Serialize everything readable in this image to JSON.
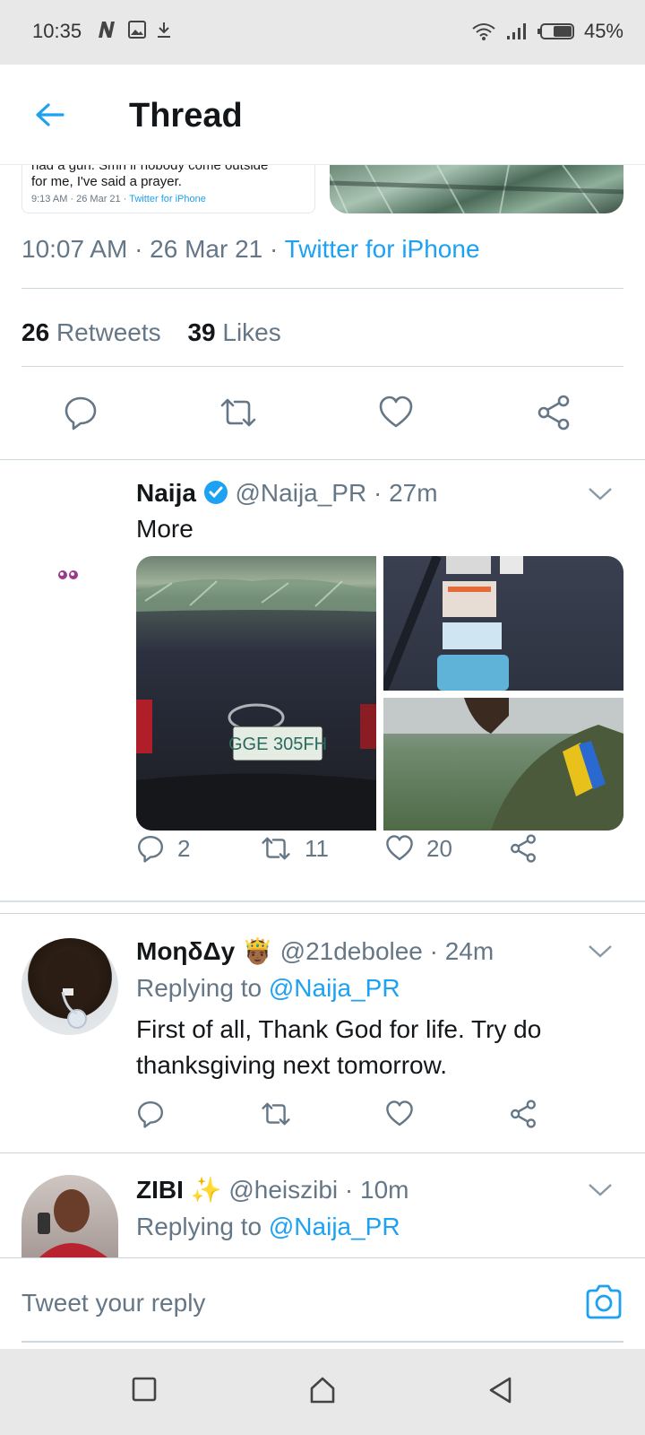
{
  "status_bar": {
    "time": "10:35",
    "battery": "45%"
  },
  "header": {
    "title": "Thread"
  },
  "quoted_tweet": {
    "cut_text": "had a gun. Smh if nobody come outside",
    "text": "for me, I've said a prayer.",
    "time": "9:13 AM · 26 Mar 21 · ",
    "source": "Twitter for iPhone"
  },
  "main_tweet": {
    "time": "10:07 AM · 26 Mar 21 · ",
    "source": "Twitter for iPhone",
    "retweets_count": "26",
    "retweets_label": "Retweets",
    "likes_count": "39",
    "likes_label": "Likes"
  },
  "tweets": [
    {
      "name": "Naija",
      "handle": "@Naija_PR · 27m",
      "text": "More",
      "replies": "2",
      "retweets": "11",
      "likes": "20",
      "plate_text": "GGE 305FH"
    },
    {
      "name": "ΜοηδΔy",
      "emoji": "🤴🏾",
      "handle": "@21debolee · 24m",
      "replying_prefix": "Replying to ",
      "replying_to": "@Naija_PR",
      "text": "First of all, Thank God for life. Try do thanksgiving next tomorrow."
    },
    {
      "name": "ZIBI",
      "emoji": "✨",
      "handle": "@heiszibi · 10m",
      "replying_prefix": "Replying to ",
      "replying_to": "@Naija_PR"
    }
  ],
  "composer": {
    "placeholder": "Tweet your reply"
  },
  "colors": {
    "accent": "#1da1f2",
    "text": "#14171a",
    "muted": "#657786",
    "divider": "#ccd6dd"
  }
}
